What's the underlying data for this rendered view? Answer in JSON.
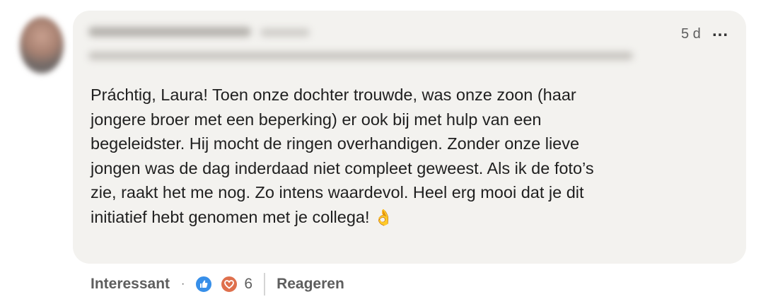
{
  "comment": {
    "time": "5 d",
    "more_label": "...",
    "lines": [
      "Práchtig, Laura! Toen onze dochter trouwde, was onze zoon (haar",
      "jongere broer met een beperking) er ook bij met hulp van een",
      "begeleidster. Hij mocht de ringen overhandigen. Zonder onze lieve",
      "jongen was de dag inderdaad niet compleet geweest. Als ik de foto’s",
      "zie, raakt het me nog. Zo intens waardevol. Heel erg mooi dat je dit",
      "initiatief hebt genomen met je collega!"
    ],
    "emoji": "👌"
  },
  "footer": {
    "react_label": "Interessant",
    "dot": "·",
    "reaction_icons": [
      "like-icon",
      "heart-icon"
    ],
    "reaction_count": "6",
    "reply_label": "Reageren"
  },
  "colors": {
    "bubble_bg": "#f3f2ef",
    "like_blue": "#378fe9",
    "love_orange": "#df704d",
    "text_muted": "#5e5e5e"
  }
}
